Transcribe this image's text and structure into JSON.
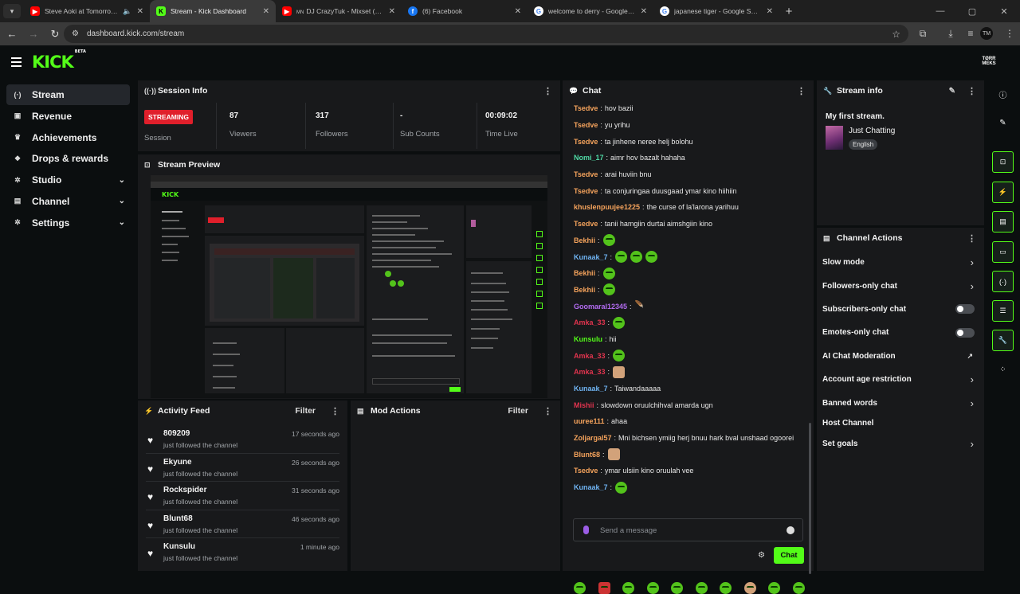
{
  "browser": {
    "tabs": [
      {
        "title": "Steve Aoki at Tomorrowland",
        "favicon": "youtube",
        "audio": true
      },
      {
        "title": "Stream - Kick Dashboard",
        "favicon": "kick",
        "active": true
      },
      {
        "title": "DJ CrazyTuk - Mixset (LIVE)",
        "favicon": "youtube",
        "prefix": "MN"
      },
      {
        "title": "(6) Facebook",
        "favicon": "facebook"
      },
      {
        "title": "welcome to derry - Google Sea",
        "favicon": "google"
      },
      {
        "title": "japanese tiger - Google Search",
        "favicon": "google"
      }
    ],
    "url": "dashboard.kick.com/stream"
  },
  "header": {
    "logo": "KICK",
    "logo_beta": "BETA",
    "user_badge": "TØRR MEKS"
  },
  "sidebar": {
    "items": [
      {
        "label": "Stream",
        "icon": "broadcast-icon"
      },
      {
        "label": "Revenue",
        "icon": "wallet-icon"
      },
      {
        "label": "Achievements",
        "icon": "trophy-icon"
      },
      {
        "label": "Drops & rewards",
        "icon": "gift-icon"
      },
      {
        "label": "Studio",
        "icon": "gear-icon",
        "expandable": true
      },
      {
        "label": "Channel",
        "icon": "screen-icon",
        "expandable": true
      },
      {
        "label": "Settings",
        "icon": "gear-icon",
        "expandable": true
      }
    ]
  },
  "session": {
    "title": "Session Info",
    "status_badge": "STREAMING",
    "status_label": "Session",
    "stats": [
      {
        "value": "87",
        "label": "Viewers"
      },
      {
        "value": "317",
        "label": "Followers"
      },
      {
        "value": "-",
        "label": "Sub Counts"
      },
      {
        "value": "00:09:02",
        "label": "Time Live"
      }
    ]
  },
  "preview": {
    "title": "Stream Preview"
  },
  "activity": {
    "title": "Activity Feed",
    "filter": "Filter",
    "items": [
      {
        "name": "809209",
        "action": "just followed the channel",
        "time": "17 seconds ago"
      },
      {
        "name": "Ekyune",
        "action": "just followed the channel",
        "time": "26 seconds ago"
      },
      {
        "name": "Rockspider",
        "action": "just followed the channel",
        "time": "31 seconds ago"
      },
      {
        "name": "Blunt68",
        "action": "just followed the channel",
        "time": "46 seconds ago"
      },
      {
        "name": "Kunsulu",
        "action": "just followed the channel",
        "time": "1 minute ago"
      }
    ]
  },
  "mod_actions": {
    "title": "Mod Actions",
    "filter": "Filter"
  },
  "chat": {
    "title": "Chat",
    "messages": [
      {
        "user": "Tsedve",
        "color": "#f5a35c",
        "text": "hov bazii"
      },
      {
        "user": "Tsedve",
        "color": "#f5a35c",
        "text": "yu yrihu"
      },
      {
        "user": "Tsedve",
        "color": "#f5a35c",
        "text": "ta jinhene neree helj bolohu"
      },
      {
        "user": "Nomi_17",
        "color": "#4fd9a5",
        "text": "aimr hov bazalt hahaha"
      },
      {
        "user": "Tsedve",
        "color": "#f5a35c",
        "text": "arai huviin bnu"
      },
      {
        "user": "Tsedve",
        "color": "#f5a35c",
        "text": "ta conjuringaa duusgaad ymar kino hiihiin"
      },
      {
        "user": "khuslenpuujee1225",
        "color": "#f5a35c",
        "text": "the curse of la'larona yarihuu"
      },
      {
        "user": "Tsedve",
        "color": "#f5a35c",
        "text": "tanii hamgiin durtai aimshgiin kino"
      },
      {
        "user": "Bekhii",
        "color": "#f5a35c",
        "text": "",
        "emotes": [
          "emote"
        ]
      },
      {
        "user": "Kunaak_7",
        "color": "#6fb3f2",
        "text": "",
        "emotes": [
          "emote",
          "emote",
          "emote"
        ]
      },
      {
        "user": "Bekhii",
        "color": "#f5a35c",
        "text": "",
        "emotes": [
          "emote"
        ]
      },
      {
        "user": "Bekhii",
        "color": "#f5a35c",
        "text": "",
        "emotes": [
          "emote"
        ]
      },
      {
        "user": "Goomaral12345",
        "color": "#b36cf2",
        "text": "",
        "emotes": [
          "bird"
        ]
      },
      {
        "user": "Amka_33",
        "color": "#e0344e",
        "text": "",
        "emotes": [
          "emote"
        ]
      },
      {
        "user": "Kunsulu",
        "color": "#53fc18",
        "text": "hii"
      },
      {
        "user": "Amka_33",
        "color": "#e0344e",
        "text": "",
        "emotes": [
          "emote"
        ]
      },
      {
        "user": "Amka_33",
        "color": "#e0344e",
        "text": "",
        "emotes": [
          "face"
        ]
      },
      {
        "user": "Kunaak_7",
        "color": "#6fb3f2",
        "text": "Taiwandaaaaa"
      },
      {
        "user": "Mishii",
        "color": "#e0344e",
        "text": "slowdown oruulchihval amarda ugn"
      },
      {
        "user": "uuree111",
        "color": "#f5a35c",
        "text": "ahaa"
      },
      {
        "user": "Zoljargal57",
        "color": "#f5a35c",
        "text": "Mni bichsen ymiig herj bnuu hark bval unshaad ogoorei"
      },
      {
        "user": "Blunt68",
        "color": "#f5a35c",
        "text": "",
        "emotes": [
          "face"
        ]
      },
      {
        "user": "Tsedve",
        "color": "#f5a35c",
        "text": "ymar ulsiin kino oruulah vee"
      },
      {
        "user": "Kunaak_7",
        "color": "#6fb3f2",
        "text": "",
        "emotes": [
          "emote"
        ]
      }
    ],
    "input_placeholder": "Send a message",
    "send_label": "Chat"
  },
  "stream_info": {
    "title": "Stream info",
    "stream_title": "My first stream.",
    "category": "Just Chatting",
    "language": "English"
  },
  "channel_actions": {
    "title": "Channel Actions",
    "items": [
      {
        "label": "Slow mode",
        "control": "chevron"
      },
      {
        "label": "Followers-only chat",
        "control": "chevron"
      },
      {
        "label": "Subscribers-only chat",
        "control": "toggle"
      },
      {
        "label": "Emotes-only chat",
        "control": "toggle"
      },
      {
        "label": "AI Chat Moderation",
        "control": "external"
      },
      {
        "label": "Account age restriction",
        "control": "chevron"
      },
      {
        "label": "Banned words",
        "control": "chevron"
      },
      {
        "label": "Host Channel",
        "control": "none"
      },
      {
        "label": "Set goals",
        "control": "chevron"
      }
    ]
  },
  "colors": {
    "accent": "#53fc18",
    "live": "#e01f2b",
    "panel": "#18191b",
    "bg": "#0b0e0f"
  }
}
